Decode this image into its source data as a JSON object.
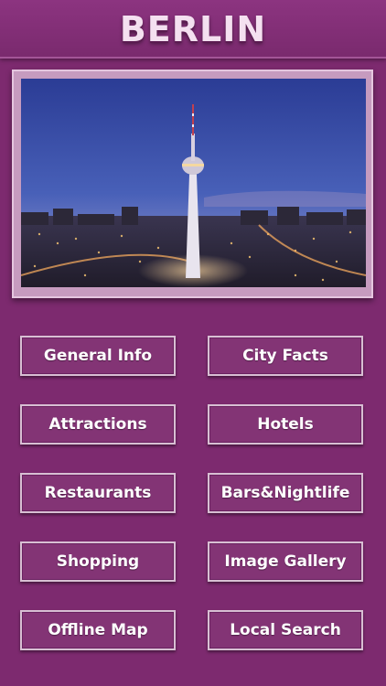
{
  "header": {
    "title": "BERLIN"
  },
  "hero": {
    "description": "night skyline with TV tower"
  },
  "menu": {
    "general_info": "General Info",
    "city_facts": "City Facts",
    "attractions": "Attractions",
    "hotels": "Hotels",
    "restaurants": "Restaurants",
    "bars_nightlife": "Bars&Nightlife",
    "shopping": "Shopping",
    "image_gallery": "Image Gallery",
    "offline_map": "Offline Map",
    "local_search": "Local Search"
  },
  "colors": {
    "background": "#7d2a6f",
    "button": "#833475",
    "button_border": "#d8bfd3",
    "title_text": "#f4e0f0"
  }
}
